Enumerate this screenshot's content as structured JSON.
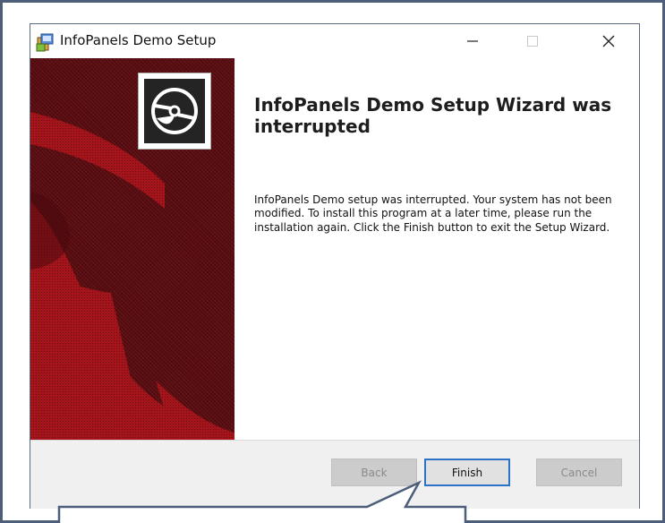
{
  "window": {
    "title": "InfoPanels Demo Setup",
    "app_icon": "setup-icon",
    "caption_buttons": [
      "minimize-icon",
      "maximize-icon",
      "close-icon"
    ]
  },
  "banner": {
    "icon": "disc-icon",
    "background_color": "#5a0b0f",
    "pattern_color": "#b0161d"
  },
  "main": {
    "heading": "InfoPanels Demo Setup Wizard was interrupted",
    "body": "InfoPanels Demo setup was interrupted. Your system has not been modified. To install this program at a later time, please run the installation again. Click the Finish button to exit the Setup Wizard."
  },
  "footer": {
    "back_label": "Back",
    "finish_label": "Finish",
    "cancel_label": "Cancel"
  },
  "colors": {
    "accent": "#2c72c7",
    "frame": "#4c5e7a"
  }
}
